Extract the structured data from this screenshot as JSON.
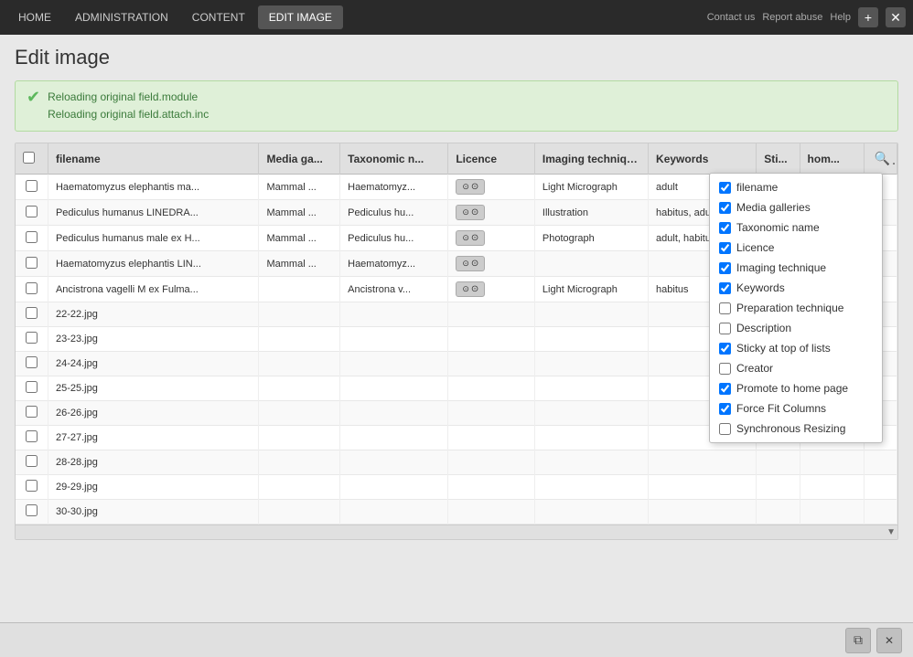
{
  "topbar": {
    "nav_items": [
      {
        "label": "HOME",
        "active": false
      },
      {
        "label": "ADMINISTRATION",
        "active": false
      },
      {
        "label": "CONTENT",
        "active": false
      },
      {
        "label": "EDIT IMAGE",
        "active": true
      }
    ],
    "top_links": [
      "Contact us",
      "Report abuse",
      "Help"
    ],
    "plus_btn": "+",
    "close_btn": "✕"
  },
  "page": {
    "title": "Edit image"
  },
  "status_messages": [
    "Reloading original field.module",
    "Reloading original field.attach.inc"
  ],
  "table": {
    "columns": [
      {
        "key": "check",
        "label": ""
      },
      {
        "key": "filename",
        "label": "filename"
      },
      {
        "key": "media_gallery",
        "label": "Media ga..."
      },
      {
        "key": "taxonomic_name",
        "label": "Taxonomic n..."
      },
      {
        "key": "licence",
        "label": "Licence"
      },
      {
        "key": "imaging_technique",
        "label": "Imaging techniqu..."
      },
      {
        "key": "keywords",
        "label": "Keywords"
      },
      {
        "key": "sticky",
        "label": "Sti..."
      },
      {
        "key": "home",
        "label": "hom..."
      }
    ],
    "rows": [
      {
        "filename": "Haematomyzus elephantis ma...",
        "media_gallery": "Mammal ...",
        "taxonomic_name": "Haematomyz...",
        "licence": "CC BY",
        "imaging_technique": "Light Micrograph",
        "keywords": "adult",
        "sticky": "",
        "home": ""
      },
      {
        "filename": "Pediculus humanus LINEDRA...",
        "media_gallery": "Mammal ...",
        "taxonomic_name": "Pediculus hu...",
        "licence": "CC BY",
        "imaging_technique": "Illustration",
        "keywords": "habitus, adult",
        "sticky": "",
        "home": ""
      },
      {
        "filename": "Pediculus humanus male ex H...",
        "media_gallery": "Mammal ...",
        "taxonomic_name": "Pediculus hu...",
        "licence": "CC BY",
        "imaging_technique": "Photograph",
        "keywords": "adult, habitus",
        "sticky": "",
        "home": ""
      },
      {
        "filename": "Haematomyzus elephantis LIN...",
        "media_gallery": "Mammal ...",
        "taxonomic_name": "Haematomyz...",
        "licence": "CC BY",
        "imaging_technique": "",
        "keywords": "",
        "sticky": "",
        "home": ""
      },
      {
        "filename": "Ancistrona vagelli M ex Fulma...",
        "media_gallery": "",
        "taxonomic_name": "Ancistrona v...",
        "licence": "CC BY",
        "imaging_technique": "Light Micrograph",
        "keywords": "habitus",
        "sticky": "",
        "home": ""
      },
      {
        "filename": "22-22.jpg",
        "media_gallery": "",
        "taxonomic_name": "",
        "licence": "",
        "imaging_technique": "",
        "keywords": "",
        "sticky": "",
        "home": ""
      },
      {
        "filename": "23-23.jpg",
        "media_gallery": "",
        "taxonomic_name": "",
        "licence": "",
        "imaging_technique": "",
        "keywords": "",
        "sticky": "",
        "home": ""
      },
      {
        "filename": "24-24.jpg",
        "media_gallery": "",
        "taxonomic_name": "",
        "licence": "",
        "imaging_technique": "",
        "keywords": "",
        "sticky": "",
        "home": ""
      },
      {
        "filename": "25-25.jpg",
        "media_gallery": "",
        "taxonomic_name": "",
        "licence": "",
        "imaging_technique": "",
        "keywords": "",
        "sticky": "",
        "home": ""
      },
      {
        "filename": "26-26.jpg",
        "media_gallery": "",
        "taxonomic_name": "",
        "licence": "",
        "imaging_technique": "",
        "keywords": "",
        "sticky": "",
        "home": ""
      },
      {
        "filename": "27-27.jpg",
        "media_gallery": "",
        "taxonomic_name": "",
        "licence": "",
        "imaging_technique": "",
        "keywords": "",
        "sticky": "",
        "home": ""
      },
      {
        "filename": "28-28.jpg",
        "media_gallery": "",
        "taxonomic_name": "",
        "licence": "",
        "imaging_technique": "",
        "keywords": "",
        "sticky": "",
        "home": ""
      },
      {
        "filename": "29-29.jpg",
        "media_gallery": "",
        "taxonomic_name": "",
        "licence": "",
        "imaging_technique": "",
        "keywords": "",
        "sticky": "",
        "home": ""
      },
      {
        "filename": "30-30.jpg",
        "media_gallery": "",
        "taxonomic_name": "",
        "licence": "",
        "imaging_technique": "",
        "keywords": "",
        "sticky": "",
        "home": ""
      }
    ]
  },
  "column_dropdown": {
    "items": [
      {
        "label": "filename",
        "checked": true
      },
      {
        "label": "Media galleries",
        "checked": true
      },
      {
        "label": "Taxonomic name",
        "checked": true
      },
      {
        "label": "Licence",
        "checked": true
      },
      {
        "label": "Imaging technique",
        "checked": true
      },
      {
        "label": "Keywords",
        "checked": true
      },
      {
        "label": "Preparation technique",
        "checked": false
      },
      {
        "label": "Description",
        "checked": false
      },
      {
        "label": "Sticky at top of lists",
        "checked": true
      },
      {
        "label": "Creator",
        "checked": false
      },
      {
        "label": "Promote to home page",
        "checked": true
      },
      {
        "label": "Force Fit Columns",
        "checked": true
      },
      {
        "label": "Synchronous Resizing",
        "checked": false
      }
    ]
  },
  "bottom_bar": {
    "copy_icon": "⧉",
    "delete_icon": "✕"
  }
}
